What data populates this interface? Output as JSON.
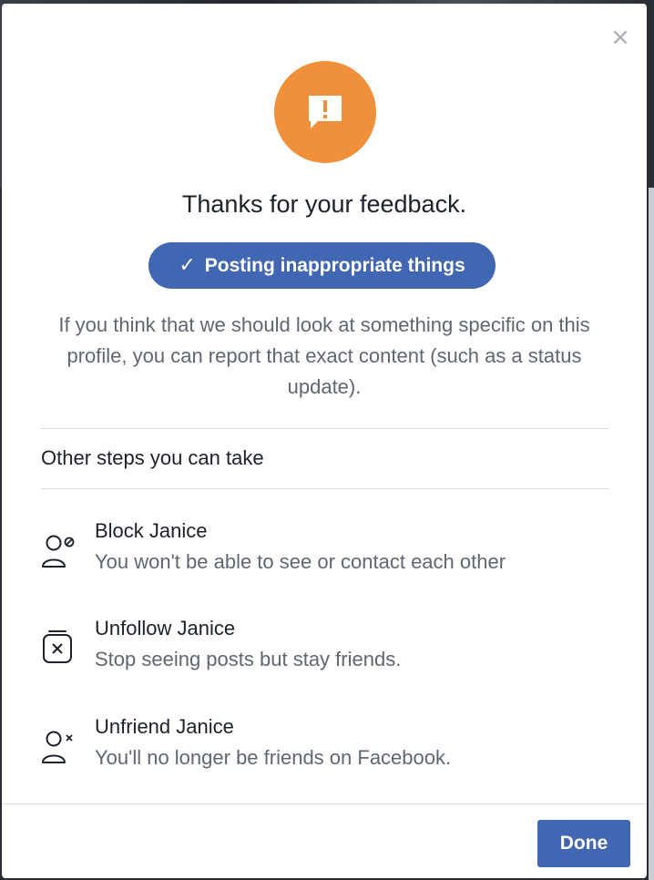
{
  "dialog": {
    "close_icon": "close-icon",
    "alert_icon": "speech-bubble-exclamation-icon",
    "title": "Thanks for your feedback.",
    "selected_reason": "Posting inappropriate things",
    "description": "If you think that we should look at something specific on this profile, you can report that exact content (such as a status update).",
    "section_title": "Other steps you can take",
    "options": [
      {
        "icon": "block-user-icon",
        "title": "Block Janice",
        "description": "You won't be able to see or contact each other"
      },
      {
        "icon": "unfollow-icon",
        "title": "Unfollow Janice",
        "description": "Stop seeing posts but stay friends."
      },
      {
        "icon": "unfriend-icon",
        "title": "Unfriend Janice",
        "description": "You'll no longer be friends on Facebook."
      }
    ],
    "done_label": "Done"
  },
  "colors": {
    "accent": "#4267b2",
    "alert": "#f0903a",
    "text_primary": "#1d2129",
    "text_secondary": "#606770",
    "divider": "#dadde1"
  }
}
